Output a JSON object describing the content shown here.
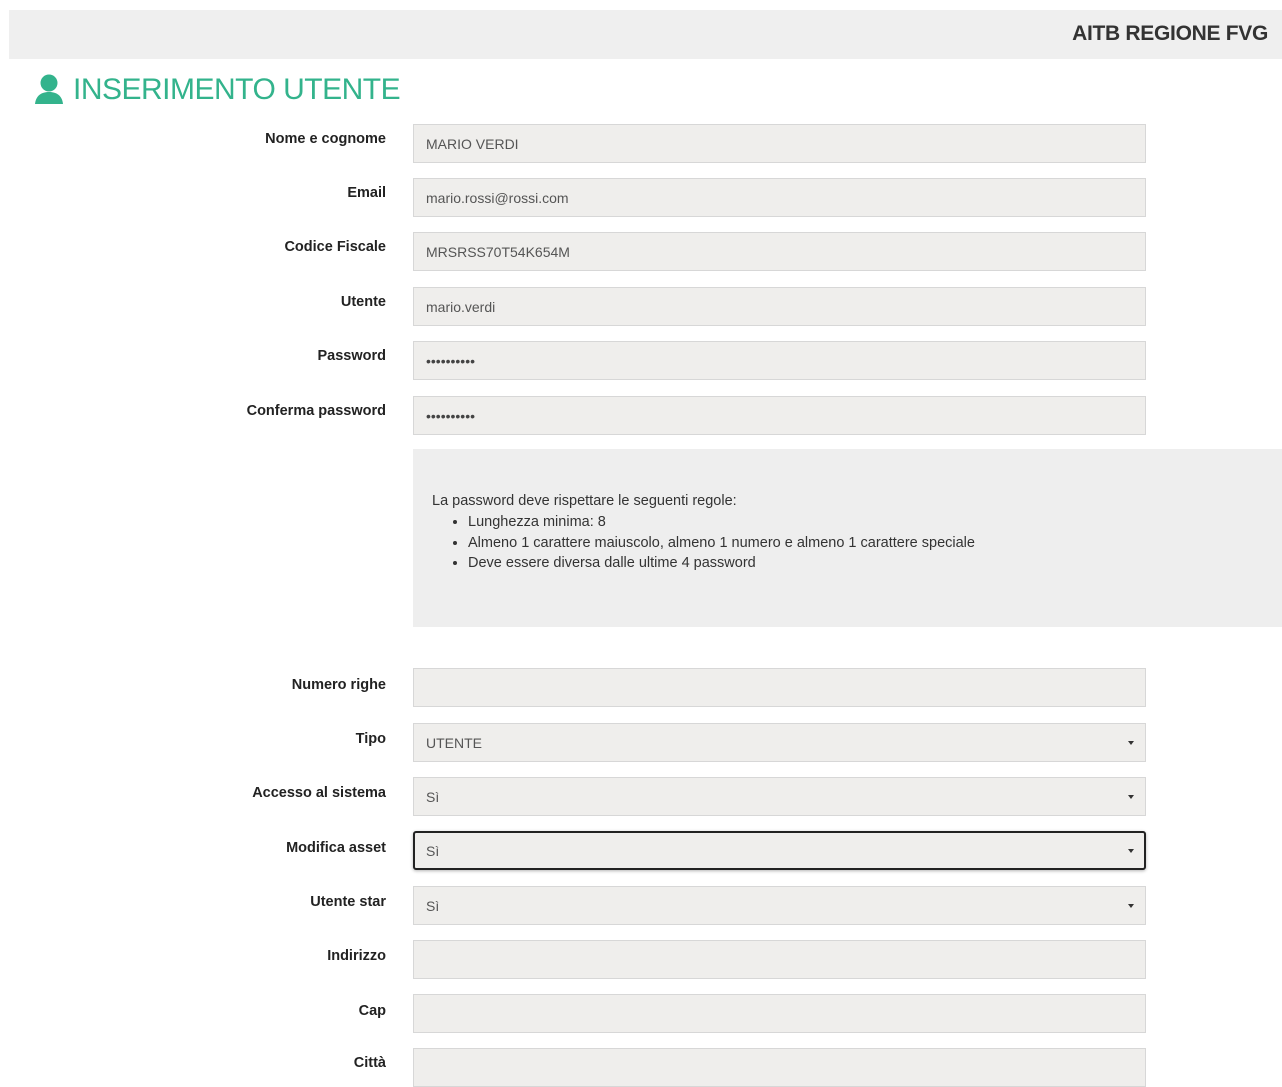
{
  "header": {
    "brand": "AITB REGIONE FVG"
  },
  "page": {
    "title": "INSERIMENTO UTENTE"
  },
  "form": {
    "nome_label": "Nome e cognome",
    "nome_value": "MARIO VERDI",
    "email_label": "Email",
    "email_value": "mario.rossi@rossi.com",
    "cf_label": "Codice Fiscale",
    "cf_value": "MRSRSS70T54K654M",
    "utente_label": "Utente",
    "utente_value": "mario.verdi",
    "password_label": "Password",
    "password_value": "••••••••••",
    "conferma_label": "Conferma password",
    "conferma_value": "••••••••••",
    "rules": {
      "intro": "La password deve rispettare le seguenti regole:",
      "items": [
        "Lunghezza minima: 8",
        "Almeno 1 carattere maiuscolo, almeno 1 numero e almeno 1 carattere speciale",
        "Deve essere diversa dalle ultime 4 password"
      ]
    },
    "righe_label": "Numero righe",
    "righe_value": "",
    "tipo_label": "Tipo",
    "tipo_value": "UTENTE",
    "accesso_label": "Accesso al sistema",
    "accesso_value": "Sì",
    "modifica_label": "Modifica asset",
    "modifica_value": "Sì",
    "star_label": "Utente star",
    "star_value": "Sì",
    "indirizzo_label": "Indirizzo",
    "indirizzo_value": "",
    "cap_label": "Cap",
    "cap_value": "",
    "citta_label": "Città",
    "citta_value": ""
  },
  "colors": {
    "accent": "#33b38c",
    "field_bg": "#efeeec",
    "topbar_bg": "#efefef"
  },
  "icons": {
    "heading": "user-icon",
    "select": "caret-down-icon"
  }
}
